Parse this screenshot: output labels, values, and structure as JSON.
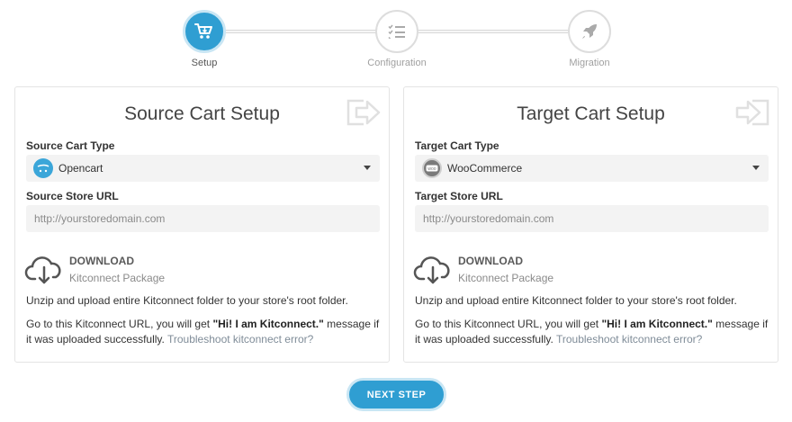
{
  "stepper": {
    "steps": [
      {
        "label": "Setup",
        "icon": "cart-icon",
        "active": true
      },
      {
        "label": "Configuration",
        "icon": "checklist-icon",
        "active": false
      },
      {
        "label": "Migration",
        "icon": "rocket-icon",
        "active": false
      }
    ]
  },
  "source": {
    "title": "Source Cart Setup",
    "deco_icon": "export-arrow-icon",
    "cart_type_label": "Source Cart Type",
    "cart_type_value": "Opencart",
    "cart_logo": "opencart-logo",
    "store_url_label": "Source Store URL",
    "store_url_placeholder": "http://yourstoredomain.com",
    "download_title": "DOWNLOAD",
    "download_sub": "Kitconnect Package",
    "instruction_1": "Unzip and upload entire Kitconnect folder to your store's root folder.",
    "instruction_2_pre": "Go to this Kitconnect URL, you will get ",
    "instruction_2_bold": "\"Hi! I am Kitconnect.\"",
    "instruction_2_post": " message if it was uploaded successfully.",
    "troubleshoot_link": "Troubleshoot kitconnect error?"
  },
  "target": {
    "title": "Target Cart Setup",
    "deco_icon": "import-arrow-icon",
    "cart_type_label": "Target Cart Type",
    "cart_type_value": "WooCommerce",
    "cart_logo": "woocommerce-logo",
    "store_url_label": "Target Store URL",
    "store_url_placeholder": "http://yourstoredomain.com",
    "download_title": "DOWNLOAD",
    "download_sub": "Kitconnect Package",
    "instruction_1": "Unzip and upload entire Kitconnect folder to your store's root folder.",
    "instruction_2_pre": "Go to this Kitconnect URL, you will get ",
    "instruction_2_bold": "\"Hi! I am Kitconnect.\"",
    "instruction_2_post": " message if it was uploaded successfully.",
    "troubleshoot_link": "Troubleshoot kitconnect error?"
  },
  "actions": {
    "next_label": "NEXT STEP"
  },
  "colors": {
    "accent": "#2f9ed2",
    "accent_ring": "#c9e6f4",
    "input_bg": "#f3f3f3"
  }
}
